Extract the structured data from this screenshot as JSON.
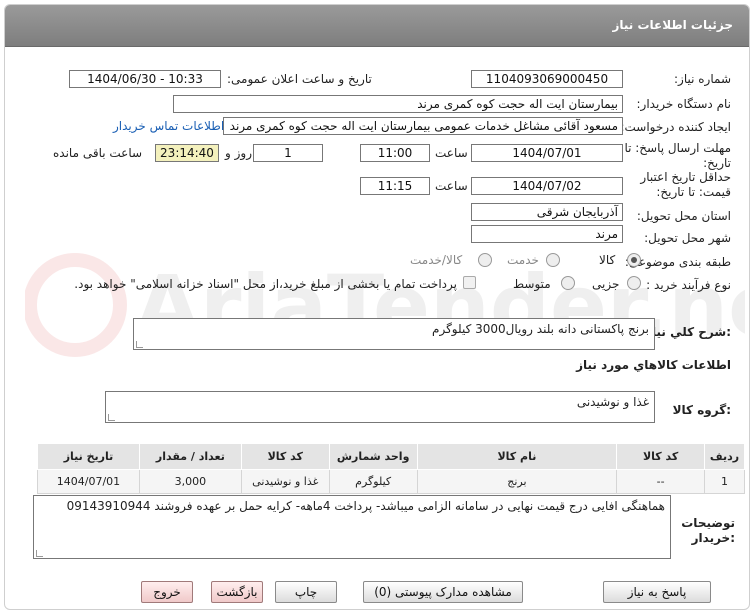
{
  "header": {
    "title": "جزئیات اطلاعات نیاز"
  },
  "labels": {
    "need_number": "شماره نیاز:",
    "announce_datetime": "تاریخ و ساعت اعلان عمومی:",
    "buyer_org": "نام دستگاه خریدار:",
    "requester": "ایجاد کننده درخواست:",
    "reply_deadline_line1": "مهلت ارسال پاسخ: تا",
    "reply_deadline_line2": "تاریخ:",
    "price_validity_line1": "حداقل تاریخ اعتبار",
    "price_validity_line2": "قیمت: تا تاریخ:",
    "time1": "ساعت",
    "time2": "ساعت",
    "day_and": "روز و",
    "remaining": "ساعت باقی مانده",
    "province": "استان محل تحویل:",
    "city": "شهر محل تحویل:",
    "category": "طبقه بندی موضوعی:",
    "process_type": "نوع فرآیند خرید :",
    "general_desc": "شرح کلي نياز:",
    "goods_info": "اطلاعات کالاهاي مورد نياز",
    "goods_group": "گروه کالا:",
    "buyer_notes_line1": "توضیحات",
    "buyer_notes_line2": "خریدار:"
  },
  "fields": {
    "need_number": "1104093069000450",
    "announce_datetime": "1404/06/30 - 10:33",
    "buyer_org": "بیمارستان ایت اله حجت کوه کمری مرند",
    "requester": "مسعود آقائی مشاغل خدمات عمومی بیمارستان ایت اله حجت کوه کمری مرند",
    "contact_link": "اطلاعات تماس خریدار",
    "reply_date": "1404/07/01",
    "reply_time": "11:00",
    "reply_days": "1",
    "reply_remaining": "23:14:40",
    "validity_date": "1404/07/02",
    "validity_time": "11:15",
    "province": "آذربایجان شرقی",
    "city": "مرند",
    "general_desc": "برنج پاکستانی دانه بلند رویال3000 کیلوگرم",
    "goods_group": "غذا و نوشیدنی",
    "buyer_notes": "هماهنگی افایی درج قیمت نهایی در سامانه الزامی میباشد- پرداخت 4ماهه- کرایه حمل بر عهده فروشند 09143910944"
  },
  "category_options": [
    "کالا",
    "خدمت",
    "کالا/خدمت"
  ],
  "category_selected": "کالا",
  "process_options": [
    "جزیی",
    "متوسط"
  ],
  "process_selected": "جزیی",
  "treasury_note": "پرداخت تمام یا بخشی از مبلغ خرید،از محل \"اسناد خزانه اسلامی\" خواهد بود.",
  "table": {
    "headers": [
      "ردیف",
      "کد کالا",
      "نام کالا",
      "واحد شمارش",
      "کد کالا",
      "تعداد / مقدار",
      "تاریخ نیاز"
    ],
    "rows": [
      [
        "1",
        "--",
        "برنج",
        "کیلوگرم",
        "غذا و نوشیدنی",
        "3,000",
        "1404/07/01"
      ]
    ]
  },
  "buttons": {
    "reply": "پاسخ به نیاز",
    "view_docs": "مشاهده مدارک پیوستی (0)",
    "print": "چاپ",
    "back": "بازگشت",
    "exit": "خروج"
  },
  "watermark": "AriaTender.neT"
}
